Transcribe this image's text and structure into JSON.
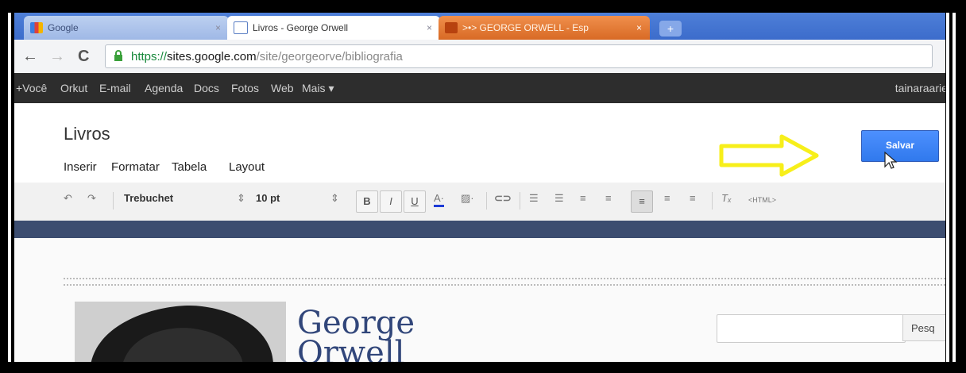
{
  "browser": {
    "tabs": [
      {
        "label": "Google",
        "close": "×"
      },
      {
        "label": "Livros - George Orwell",
        "close": "×"
      },
      {
        "label": ">•> GEORGE ORWELL - Esp",
        "close": "×"
      }
    ],
    "new_tab": "+",
    "url": {
      "protocol": "https://",
      "host": "sites.google.com",
      "path": "/site/georgeorve/bibliografia"
    }
  },
  "google_bar": {
    "items": [
      "+Você",
      "Orkut",
      "E-mail",
      "Agenda",
      "Docs",
      "Fotos",
      "Web",
      "Mais ▾"
    ],
    "user": "tainaraariel"
  },
  "editor": {
    "page_title": "Livros",
    "menu": [
      "Inserir",
      "Formatar",
      "Tabela",
      "Layout"
    ],
    "save_label": "Salvar",
    "toolbar": {
      "font": "Trebuchet",
      "size": "10 pt",
      "html_label": "<HTML>"
    }
  },
  "page": {
    "site_title_line1": "George",
    "site_title_line2": "Orwell",
    "search_button": "Pesq"
  },
  "colors": {
    "save_button": "#4d90fe",
    "arrow": "#f7ef1a",
    "header_band": "#3c4d70"
  }
}
